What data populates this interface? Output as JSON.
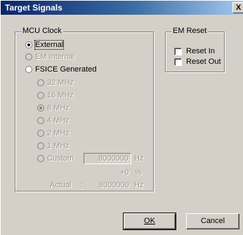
{
  "window": {
    "title": "Target Signals",
    "close_glyph": "X"
  },
  "mcu_clock": {
    "legend": "MCU Clock",
    "external": "External",
    "em_internal": "EM Internal",
    "fsice_generated": "FSICE Generated",
    "freq_32": "32 MHz",
    "freq_16": "16 MHz",
    "freq_8": "8 MHz",
    "freq_4": "4 MHz",
    "freq_2": "2 MHz",
    "freq_1": "1 MHz",
    "custom": "Custom",
    "custom_value": "8000000",
    "hz_unit": "Hz",
    "offset_value": "+0",
    "percent_unit": "%",
    "actual_label": "Actual",
    "actual_sep": ":",
    "actual_value": "8000000",
    "actual_unit": "Hz",
    "selected_source": "External",
    "selected_frequency": "8 MHz"
  },
  "em_reset": {
    "legend": "EM Reset",
    "reset_in": "Reset In",
    "reset_out": "Reset Out"
  },
  "buttons": {
    "ok": "OK",
    "cancel": "Cancel"
  }
}
